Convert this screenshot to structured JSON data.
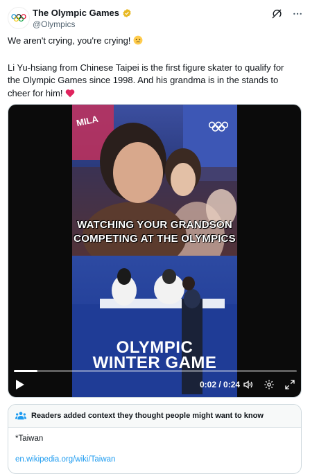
{
  "account": {
    "name": "The Olympic Games",
    "handle": "@Olympics"
  },
  "tweet": {
    "line1": "We aren't crying, you're crying!",
    "line2": "Li Yu-hsiang from Chinese Taipei is the first figure skater to qualify for the Olympic Games since 1998. And his grandma is in the stands to cheer for him!"
  },
  "video": {
    "caption_line1": "WATCHING YOUR GRANDSON",
    "caption_line2": "COMPETING AT THE OLYMPICS",
    "sign_text": "MILA",
    "banner_line1": "OLYMPIC",
    "banner_line2": "WINTER GAME",
    "time": "0:02 / 0:24",
    "progress_fraction": 0.083
  },
  "note": {
    "heading": "Readers added context they thought people might want to know",
    "text": "*Taiwan",
    "link": "en.wikipedia.org/wiki/Taiwan"
  },
  "colors": {
    "link": "#1d9bf0",
    "verified": "#e8b923",
    "heart": "#e0245e"
  }
}
